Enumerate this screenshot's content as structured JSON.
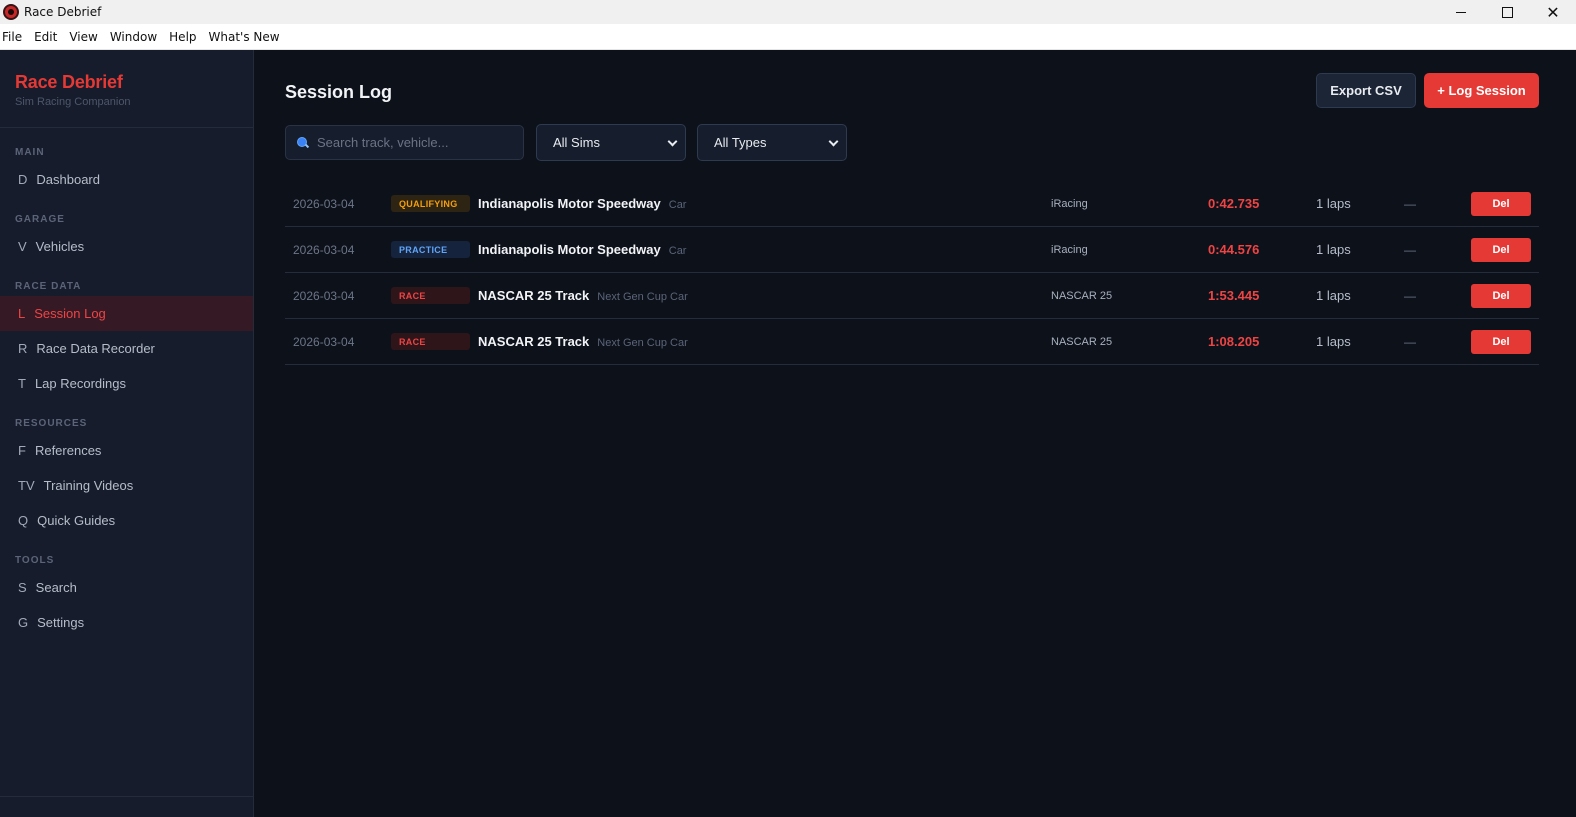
{
  "window": {
    "title": "Race Debrief"
  },
  "menu": [
    "File",
    "Edit",
    "View",
    "Window",
    "Help",
    "What's New"
  ],
  "brand": {
    "name": "Race Debrief",
    "subtitle": "Sim Racing Companion"
  },
  "sidebar": {
    "sections": [
      {
        "label": "MAIN",
        "items": [
          {
            "key": "D",
            "label": "Dashboard"
          }
        ]
      },
      {
        "label": "GARAGE",
        "items": [
          {
            "key": "V",
            "label": "Vehicles"
          }
        ]
      },
      {
        "label": "RACE DATA",
        "items": [
          {
            "key": "L",
            "label": "Session Log"
          },
          {
            "key": "R",
            "label": "Race Data Recorder"
          },
          {
            "key": "T",
            "label": "Lap Recordings"
          }
        ]
      },
      {
        "label": "RESOURCES",
        "items": [
          {
            "key": "F",
            "label": "References"
          },
          {
            "key": "TV",
            "label": "Training Videos"
          },
          {
            "key": "Q",
            "label": "Quick Guides"
          }
        ]
      },
      {
        "label": "TOOLS",
        "items": [
          {
            "key": "S",
            "label": "Search"
          },
          {
            "key": "G",
            "label": "Settings"
          }
        ]
      }
    ],
    "active": "Session Log"
  },
  "main": {
    "title": "Session Log",
    "export_label": "Export CSV",
    "log_label": "+ Log Session",
    "search_placeholder": "Search track, vehicle...",
    "filter_sims": "All Sims",
    "filter_types": "All Types",
    "sessions": [
      {
        "date": "2026-03-04",
        "type": "QUALIFYING",
        "type_class": "qualifying",
        "track": "Indianapolis Motor Speedway",
        "vehicle": "Car",
        "sim": "iRacing",
        "best": "0:42.735",
        "laps": "1 laps",
        "extra": "—",
        "del": "Del"
      },
      {
        "date": "2026-03-04",
        "type": "PRACTICE",
        "type_class": "practice",
        "track": "Indianapolis Motor Speedway",
        "vehicle": "Car",
        "sim": "iRacing",
        "best": "0:44.576",
        "laps": "1 laps",
        "extra": "—",
        "del": "Del"
      },
      {
        "date": "2026-03-04",
        "type": "RACE",
        "type_class": "race",
        "track": "NASCAR 25 Track",
        "vehicle": "Next Gen Cup Car",
        "sim": "NASCAR 25",
        "best": "1:53.445",
        "laps": "1 laps",
        "extra": "—",
        "del": "Del"
      },
      {
        "date": "2026-03-04",
        "type": "RACE",
        "type_class": "race",
        "track": "NASCAR 25 Track",
        "vehicle": "Next Gen Cup Car",
        "sim": "NASCAR 25",
        "best": "1:08.205",
        "laps": "1 laps",
        "extra": "—",
        "del": "Del"
      }
    ]
  },
  "colors": {
    "accent": "#e53935",
    "background": "#0d111a",
    "sidebar": "#161c2b",
    "qualifying": "#f59e0b",
    "practice": "#60a5fa",
    "race": "#ef4444"
  }
}
